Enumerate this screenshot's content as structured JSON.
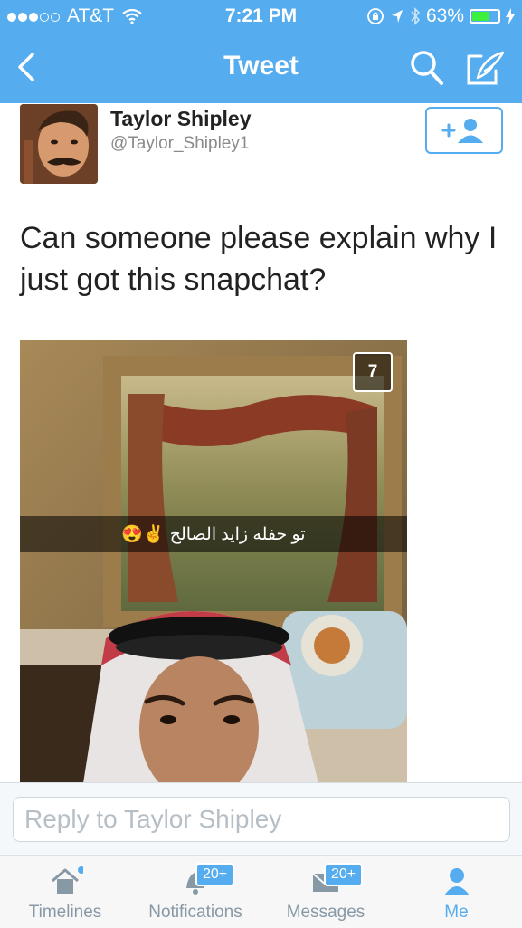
{
  "status_bar": {
    "carrier": "AT&T",
    "time": "7:21 PM",
    "battery": "63%",
    "battery_level": 0.63
  },
  "nav": {
    "title": "Tweet",
    "back_icon": "chevron-left-icon",
    "search_icon": "search-icon",
    "compose_icon": "compose-icon"
  },
  "tweet": {
    "author_name": "Taylor Shipley",
    "author_handle": "@Taylor_Shipley1",
    "text": "Can someone please explain why I just got this snapchat?",
    "follow_icon": "add-user-icon",
    "media": {
      "caption": "تو حفله زايد الصالح",
      "caption_emoji": "😍✌",
      "timer": "7"
    }
  },
  "reply": {
    "placeholder": "Reply to Taylor Shipley"
  },
  "tabs": [
    {
      "label": "Timelines",
      "icon": "home-icon",
      "badge": ""
    },
    {
      "label": "Notifications",
      "icon": "bell-icon",
      "badge": "20+"
    },
    {
      "label": "Messages",
      "icon": "envelope-icon",
      "badge": "20+"
    },
    {
      "label": "Me",
      "icon": "person-icon",
      "badge": ""
    }
  ],
  "colors": {
    "brand": "#55acee",
    "active_tab": "#55acee",
    "inactive_tab": "#8899a6"
  }
}
